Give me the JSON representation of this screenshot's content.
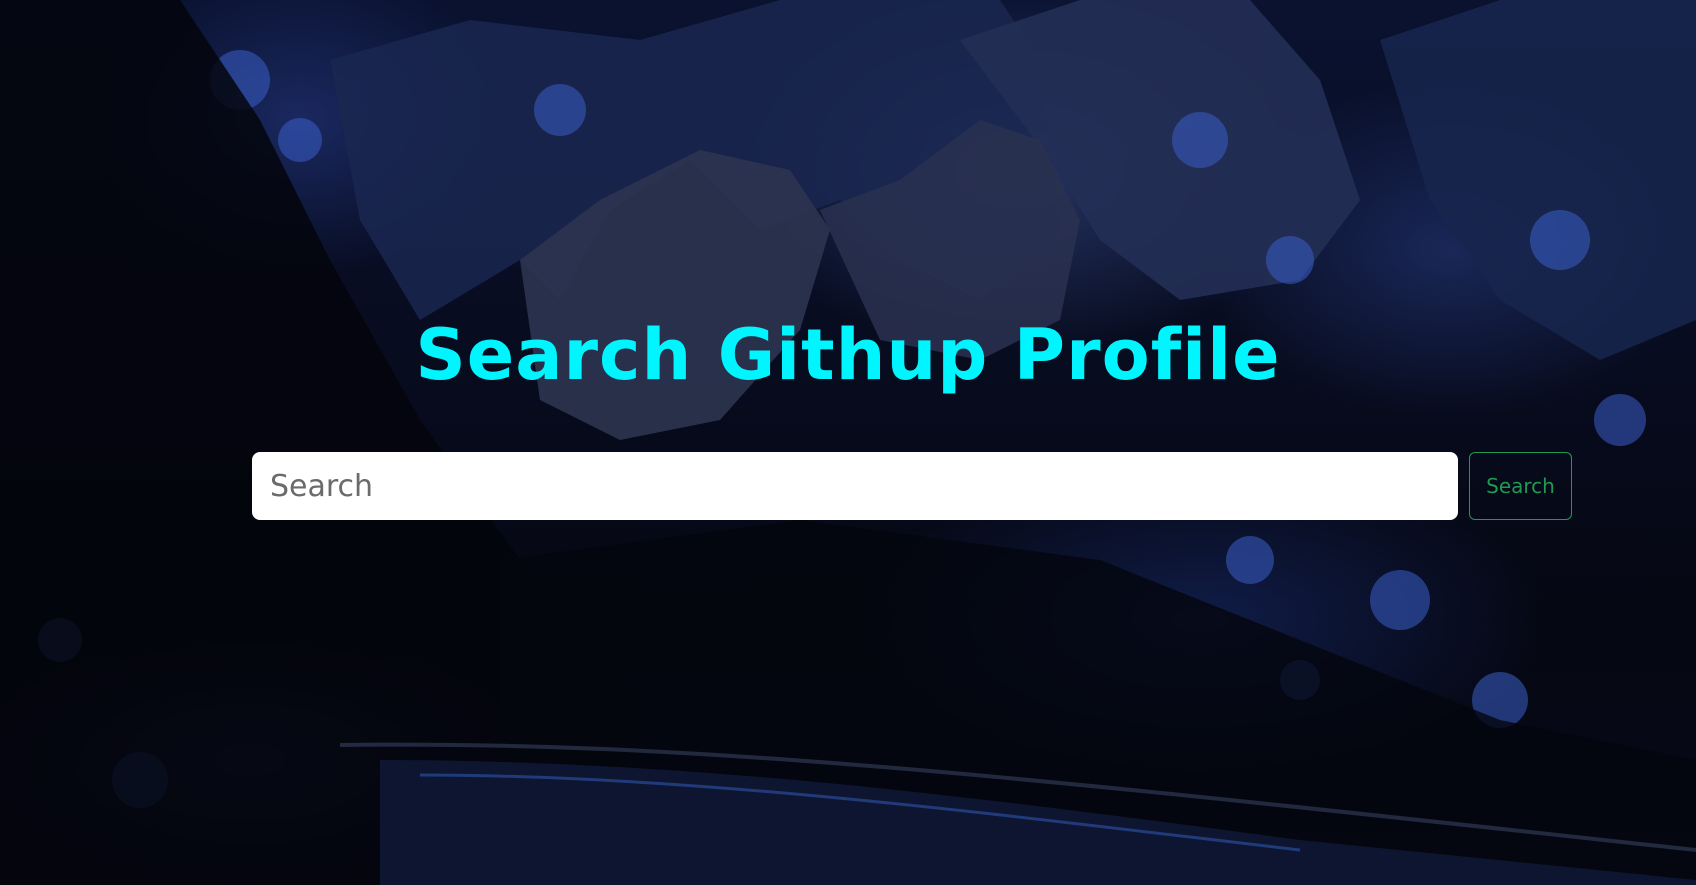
{
  "page": {
    "title": "Search Githup Profile",
    "title_color": "#00f5ff",
    "background_description_colors": {
      "primary": "#05070f",
      "accent": "#2a4a9a"
    }
  },
  "search": {
    "placeholder": "Search",
    "value": "",
    "button_label": "Search",
    "button_color": "#1e9a52"
  }
}
